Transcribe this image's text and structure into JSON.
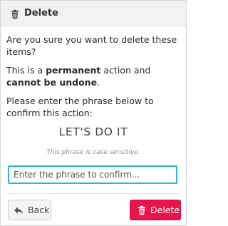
{
  "dialog": {
    "title": "Delete",
    "title_icon": "trash-icon"
  },
  "body": {
    "question": "Are you sure you want to delete these items?",
    "warning_prefix": "This is a ",
    "warning_permanent": "permanent",
    "warning_middle": " action and ",
    "warning_cannot": "cannot be undone",
    "warning_suffix": ".",
    "instruction": "Please enter the phrase below to confirm this action:"
  },
  "confirm": {
    "phrase": "LET'S DO IT",
    "case_note": "This phrase is case sensitive.",
    "input_placeholder": "Enter the phrase to confirm...",
    "input_value": ""
  },
  "actions": {
    "back_label": "Back",
    "back_icon": "reply-arrow-icon",
    "delete_label": "Delete",
    "delete_icon": "trash-icon"
  },
  "colors": {
    "accent_input_border": "#2db8c5",
    "danger": "#e8144b",
    "header_bg": "#f2f2f2"
  }
}
